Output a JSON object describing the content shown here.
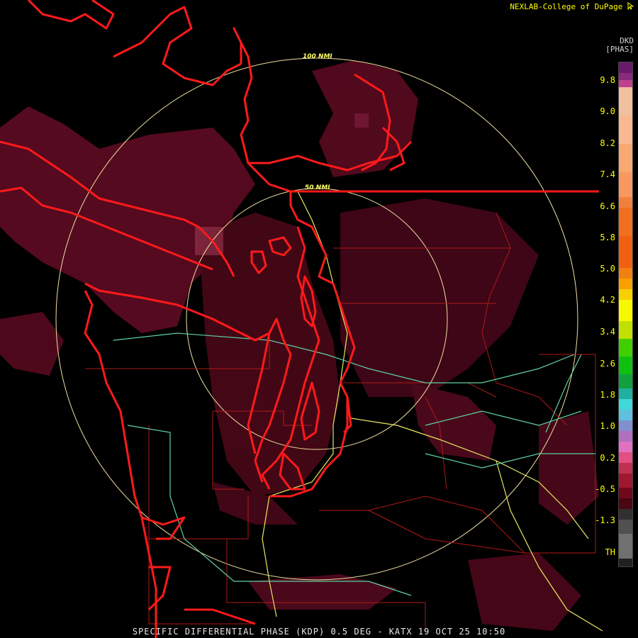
{
  "credit": "NEXLAB-College of DuPage",
  "credit_icon": "cursor-arrow-icon",
  "legend": {
    "product": "DKD",
    "units": "[PHAS]",
    "labels": [
      "9.8",
      "9.0",
      "8.2",
      "7.4",
      "6.6",
      "5.8",
      "5.0",
      "4.2",
      "3.4",
      "2.6",
      "1.8",
      "1.0",
      "0.2",
      "-0.5",
      "-1.3",
      "TH"
    ]
  },
  "range_rings": [
    "100 NMI",
    "50 NMI"
  ],
  "footer": "SPECIFIC DIFFERENTIAL PHASE (KDP) 0.5 DEG - KATX 19 OCT 25 10:50",
  "colors": {
    "background": "#000000",
    "coastline": "#ff1a1a",
    "county_lines": "#cc1a1a",
    "highways_yellow": "#e8e860",
    "highways_green": "#60d0a0",
    "range_rings": "#f0e0a0",
    "echo_dark": "#5a0a1e",
    "echo_mid": "#8a1a3a"
  }
}
